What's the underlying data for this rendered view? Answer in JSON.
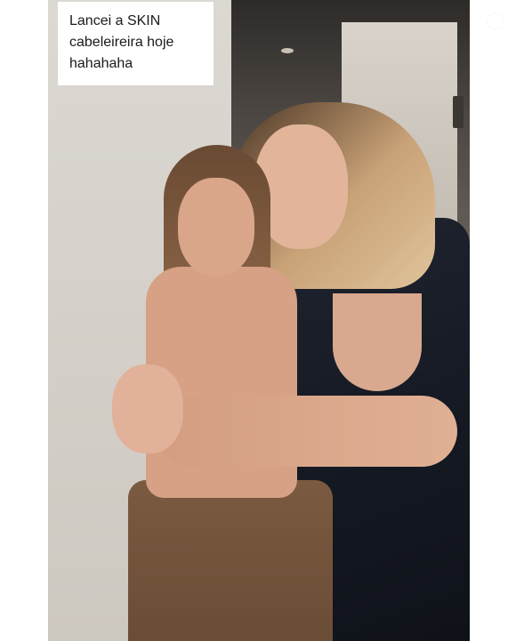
{
  "caption": {
    "lines": [
      "Lancei a SKIN",
      "cabeleireira hoje",
      "hahahaha"
    ]
  },
  "photo": {
    "description_icon": "photo-image"
  },
  "corner_icon": "watermark-icon"
}
